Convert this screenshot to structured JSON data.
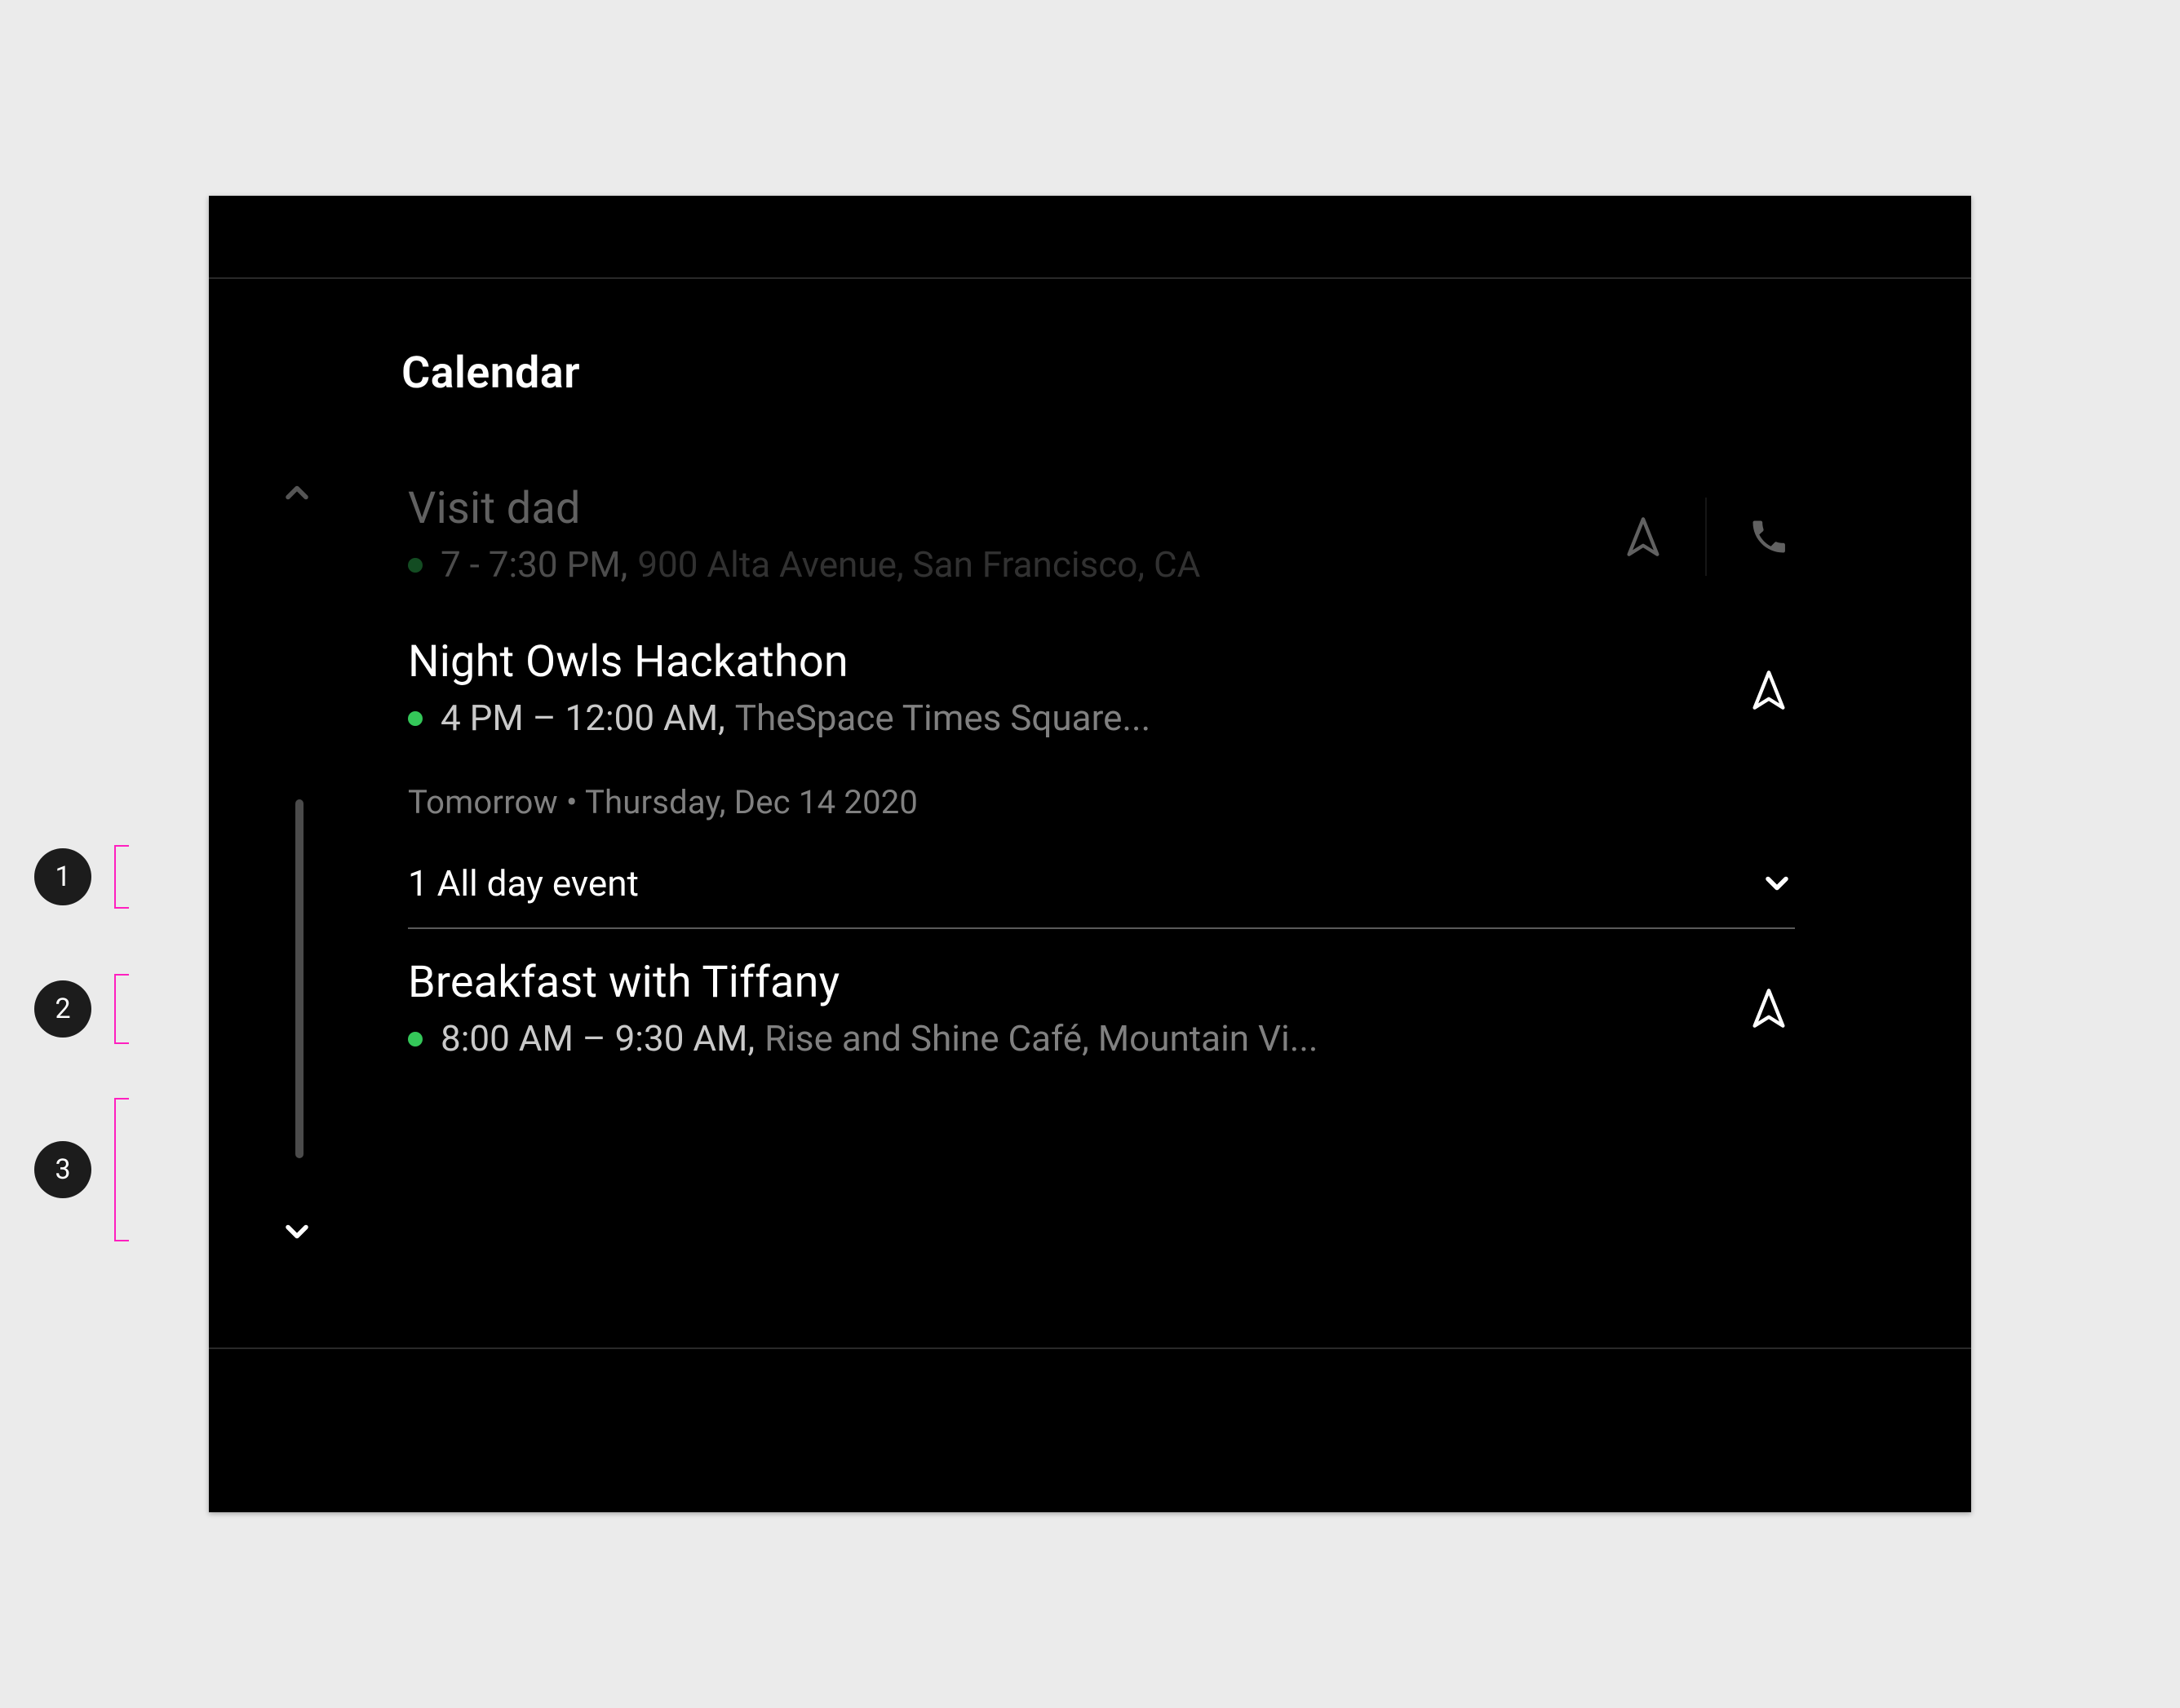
{
  "app": {
    "title": "Calendar"
  },
  "events": [
    {
      "title": "Visit dad",
      "time": "7 - 7:30 PM,",
      "location": "900 Alta Avenue, San Francisco, CA",
      "dimmed": true,
      "actions": {
        "navigate": true,
        "call": true
      }
    },
    {
      "title": "Night Owls Hackathon",
      "time": "4 PM – 12:00 AM,",
      "location": "TheSpace Times Square...",
      "dimmed": false,
      "actions": {
        "navigate": true,
        "call": false
      }
    },
    {
      "title": "Breakfast with Tiffany",
      "time": "8:00 AM – 9:30 AM,",
      "location": "Rise and Shine Café, Mountain Vi...",
      "dimmed": false,
      "actions": {
        "navigate": true,
        "call": false
      }
    }
  ],
  "section": {
    "label": "Tomorrow • Thursday, Dec 14 2020"
  },
  "allday": {
    "label": "1 All day event"
  },
  "callouts": {
    "one": "1",
    "two": "2",
    "three": "3"
  },
  "colors": {
    "dot": "#34c759",
    "accent": "#ff1fbf"
  }
}
